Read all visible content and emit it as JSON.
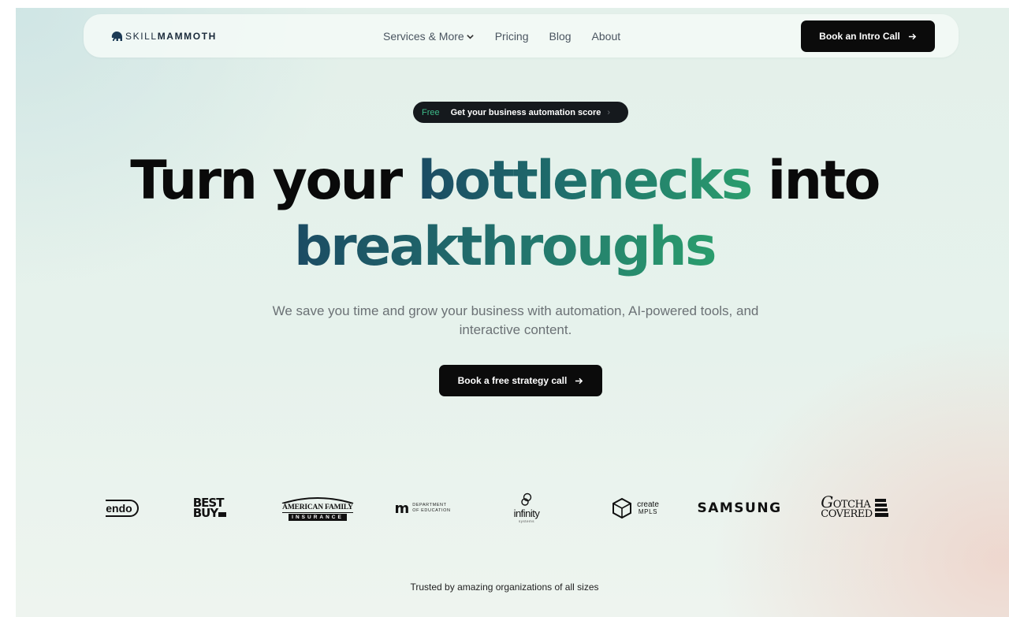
{
  "brand": {
    "name_light": "SKILL",
    "name_bold": "MAMMOTH"
  },
  "nav": {
    "links": [
      {
        "label": "Services & More"
      },
      {
        "label": "Pricing"
      },
      {
        "label": "Blog"
      },
      {
        "label": "About"
      }
    ],
    "cta_label": "Book an Intro Call"
  },
  "promo": {
    "tag": "Free",
    "text": "Get your business automation score",
    "chevron": "›"
  },
  "hero": {
    "line1_start": "Turn your ",
    "line1_highlight": "bottlenecks",
    "line1_end": " into",
    "line2_highlight": "breakthroughs",
    "subtitle": "We save you time and grow your business with automation, AI-powered tools, and interactive content.",
    "cta_label": "Book a free strategy call"
  },
  "logos": {
    "nintendo": "endo",
    "bestbuy_line1": "BEST",
    "bestbuy_line2": "BUY",
    "amfam_top": "AMERICAN FAMILY",
    "amfam_bottom": "INSURANCE",
    "mn_mark": "m",
    "mn_line1": "DEPARTMENT",
    "mn_line2": "OF EDUCATION",
    "infinity": "infinity",
    "infinity_sub": "systems",
    "create_line1": "create",
    "create_line2": "MPLS",
    "samsung": "SAMSUNG",
    "gotcha_line1": "OTCHA",
    "gotcha_initial": "G",
    "gotcha_line2": "COVERED"
  },
  "trusted_text": "Trusted by amazing organizations of all sizes",
  "colors": {
    "accent_green": "#2a9d6d",
    "accent_teal": "#1b4b63",
    "dark": "#0b0b0b"
  }
}
